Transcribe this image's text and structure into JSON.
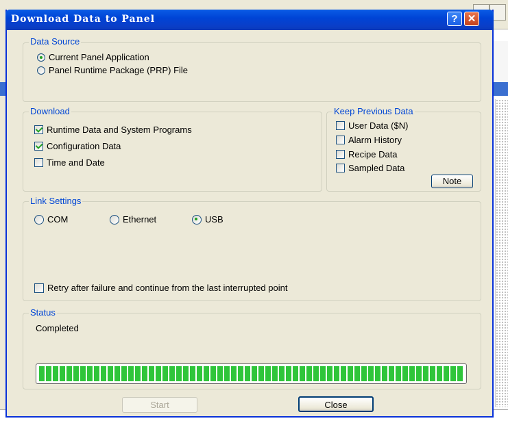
{
  "dialog": {
    "title": "Download Data to Panel",
    "help_glyph": "?",
    "close_glyph": "✕"
  },
  "data_source": {
    "legend": "Data Source",
    "options": [
      {
        "label": "Current Panel Application",
        "selected": true
      },
      {
        "label": "Panel Runtime Package (PRP) File",
        "selected": false
      }
    ]
  },
  "download": {
    "legend": "Download",
    "items": [
      {
        "label": "Runtime Data and System Programs",
        "checked": true
      },
      {
        "label": "Configuration Data",
        "checked": true
      },
      {
        "label": "Time and Date",
        "checked": false
      }
    ]
  },
  "keep_previous": {
    "legend": "Keep Previous Data",
    "items": [
      {
        "label": "User Data ($N)",
        "checked": false
      },
      {
        "label": "Alarm History",
        "checked": false
      },
      {
        "label": "Recipe Data",
        "checked": false
      },
      {
        "label": "Sampled Data",
        "checked": false
      }
    ],
    "note_label": "Note"
  },
  "link_settings": {
    "legend": "Link Settings",
    "options": [
      {
        "label": "COM",
        "selected": false
      },
      {
        "label": "Ethernet",
        "selected": false
      },
      {
        "label": "USB",
        "selected": true
      }
    ],
    "retry_label": "Retry after failure and continue from the last interrupted point",
    "retry_checked": false
  },
  "status": {
    "legend": "Status",
    "text": "Completed",
    "progress_percent": 100
  },
  "footer": {
    "start_label": "Start",
    "close_label": "Close"
  },
  "colors": {
    "titlebar": "#0044d6",
    "legend_text": "#0046d5",
    "progress_fill": "#2fc53a",
    "dialog_bg": "#ece9d8"
  }
}
